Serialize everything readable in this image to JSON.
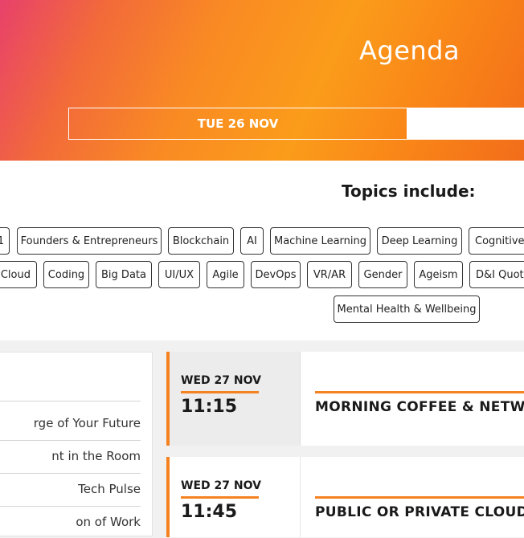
{
  "hero": {
    "title": "Agenda",
    "tabs": [
      {
        "label": "TUE 26 NOV",
        "active": true
      },
      {
        "label": "",
        "active": false
      }
    ]
  },
  "topics": {
    "heading": "Topics include:",
    "chips_row1": [
      "1",
      "Founders & Entrepreneurs",
      "Blockchain",
      "AI",
      "Machine Learning",
      "Deep Learning",
      "Cognitive"
    ],
    "chips_row2": [
      "Cloud",
      "Coding",
      "Big Data",
      "UI/UX",
      "Agile",
      "DevOps",
      "VR/AR",
      "Gender",
      "Ageism",
      "D&I Quota"
    ],
    "chips_row3": [
      "Mental Health & Wellbeing"
    ]
  },
  "sidebar": {
    "items": [
      "rge of Your Future",
      "nt in the Room",
      "Tech Pulse",
      "on of Work"
    ]
  },
  "sessions": [
    {
      "date": "WED 27 NOV",
      "time": "11:15",
      "title": "MORNING COFFEE & NETWO"
    },
    {
      "date": "WED 27 NOV",
      "time": "11:45",
      "title": "PUBLIC OR PRIVATE CLOUD?"
    }
  ],
  "colors": {
    "accent": "#f58220",
    "gradient_start": "#e8416b",
    "gradient_end": "#fb9c1a"
  }
}
